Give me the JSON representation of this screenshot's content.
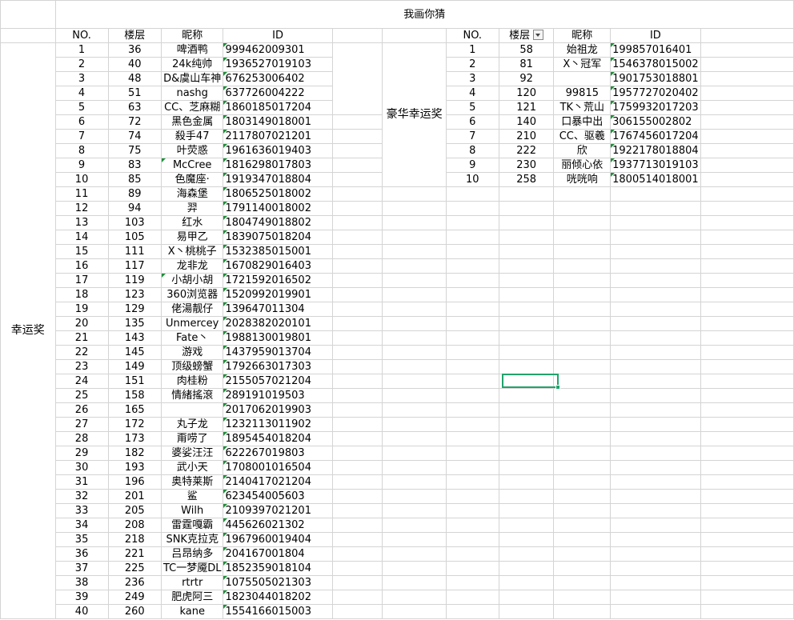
{
  "title": "我画你猜",
  "colors": {
    "grid": "#d4d4d4",
    "selection": "#22a36b",
    "comment_marker": "#1f8f3a"
  },
  "headers": {
    "no": "NO.",
    "floor": "楼层",
    "nick": "昵称",
    "id": "ID"
  },
  "left_group_label": "幸运奖",
  "right_group_label": "豪华幸运奖",
  "left_rows": [
    {
      "no": "1",
      "floor": "36",
      "nick": "啤酒鸭",
      "id": "999462009301"
    },
    {
      "no": "2",
      "floor": "40",
      "nick": "24k纯帅",
      "id": "1936527019103"
    },
    {
      "no": "3",
      "floor": "48",
      "nick": "D&虞山车神",
      "id": "676253006402"
    },
    {
      "no": "4",
      "floor": "51",
      "nick": "nashg",
      "id": "637726004222"
    },
    {
      "no": "5",
      "floor": "63",
      "nick": "CC、芝麻糊",
      "id": "1860185017204"
    },
    {
      "no": "6",
      "floor": "72",
      "nick": "黑色金属",
      "id": "1803149018001"
    },
    {
      "no": "7",
      "floor": "74",
      "nick": "殺手47",
      "id": "2117807021201"
    },
    {
      "no": "8",
      "floor": "75",
      "nick": "叶荧惑",
      "id": "1961636019403"
    },
    {
      "no": "9",
      "floor": "83",
      "nick": "McCree",
      "id": "1816298017803"
    },
    {
      "no": "10",
      "floor": "85",
      "nick": "色魔座·",
      "id": "1919347018804"
    },
    {
      "no": "11",
      "floor": "89",
      "nick": "海森堡",
      "id": "1806525018002"
    },
    {
      "no": "12",
      "floor": "94",
      "nick": "羿",
      "id": "1791140018002"
    },
    {
      "no": "13",
      "floor": "103",
      "nick": "红水",
      "id": "1804749018802"
    },
    {
      "no": "14",
      "floor": "105",
      "nick": "易甲乙",
      "id": "1839075018204"
    },
    {
      "no": "15",
      "floor": "111",
      "nick": "X丶桃桃子",
      "id": "1532385015001"
    },
    {
      "no": "16",
      "floor": "117",
      "nick": "龙非龙",
      "id": "1670829016403"
    },
    {
      "no": "17",
      "floor": "119",
      "nick": "小胡小胡",
      "id": "1721592016502"
    },
    {
      "no": "18",
      "floor": "123",
      "nick": "360浏览器",
      "id": "1520992019901"
    },
    {
      "no": "19",
      "floor": "129",
      "nick": "佬湯靓仔",
      "id": "139647011304"
    },
    {
      "no": "20",
      "floor": "135",
      "nick": "Unmercey",
      "id": "2028382020101"
    },
    {
      "no": "21",
      "floor": "143",
      "nick": "Fate丶",
      "id": "1988130019801"
    },
    {
      "no": "22",
      "floor": "145",
      "nick": "游戏",
      "id": "1437959013704"
    },
    {
      "no": "23",
      "floor": "149",
      "nick": "顶级螃蟹",
      "id": "1792663017303"
    },
    {
      "no": "24",
      "floor": "151",
      "nick": "肉桂粉",
      "id": "2155057021204"
    },
    {
      "no": "25",
      "floor": "158",
      "nick": "情緒搖滾",
      "id": "289191019503"
    },
    {
      "no": "26",
      "floor": "165",
      "nick": "",
      "id": "2017062019903"
    },
    {
      "no": "27",
      "floor": "172",
      "nick": "丸子龙",
      "id": "1232113011902"
    },
    {
      "no": "28",
      "floor": "173",
      "nick": "甭唠了",
      "id": "1895454018204"
    },
    {
      "no": "29",
      "floor": "182",
      "nick": "婆娑汪汪",
      "id": "622267019803"
    },
    {
      "no": "30",
      "floor": "193",
      "nick": "武小天",
      "id": "1708001016504"
    },
    {
      "no": "31",
      "floor": "196",
      "nick": "奥特莱斯",
      "id": "2140417021204"
    },
    {
      "no": "32",
      "floor": "201",
      "nick": "鲨",
      "id": "623454005603"
    },
    {
      "no": "33",
      "floor": "205",
      "nick": "Wilh",
      "id": "2109397021201"
    },
    {
      "no": "34",
      "floor": "208",
      "nick": "雷霆嘎霸",
      "id": "445626021302"
    },
    {
      "no": "35",
      "floor": "218",
      "nick": "SNK克拉克",
      "id": "1967960019404"
    },
    {
      "no": "36",
      "floor": "221",
      "nick": "吕昂纳多",
      "id": "204167001804"
    },
    {
      "no": "37",
      "floor": "225",
      "nick": "TC一梦魇DL",
      "id": "1852359018104"
    },
    {
      "no": "38",
      "floor": "236",
      "nick": "rtrtr",
      "id": "1075505021303"
    },
    {
      "no": "39",
      "floor": "249",
      "nick": "肥虎阿三",
      "id": "1823044018202"
    },
    {
      "no": "40",
      "floor": "260",
      "nick": "kane",
      "id": "1554166015003"
    }
  ],
  "right_rows": [
    {
      "no": "1",
      "floor": "58",
      "nick": "始祖龙",
      "id": "199857016401"
    },
    {
      "no": "2",
      "floor": "81",
      "nick": "X丶冠军",
      "id": "1546378015002"
    },
    {
      "no": "3",
      "floor": "92",
      "nick": "",
      "id": "1901753018801"
    },
    {
      "no": "4",
      "floor": "120",
      "nick": "99815",
      "id": "1957727020402"
    },
    {
      "no": "5",
      "floor": "121",
      "nick": "TK丶荒山",
      "id": "1759932017203"
    },
    {
      "no": "6",
      "floor": "140",
      "nick": "口暴中出",
      "id": "306155002802"
    },
    {
      "no": "7",
      "floor": "210",
      "nick": "CC、驱羲",
      "id": "1767456017204"
    },
    {
      "no": "8",
      "floor": "222",
      "nick": "欣",
      "id": "1922178018804"
    },
    {
      "no": "9",
      "floor": "230",
      "nick": "丽倾心依",
      "id": "1937713019103"
    },
    {
      "no": "10",
      "floor": "258",
      "nick": "咣咣响",
      "id": "1800514018001"
    }
  ]
}
